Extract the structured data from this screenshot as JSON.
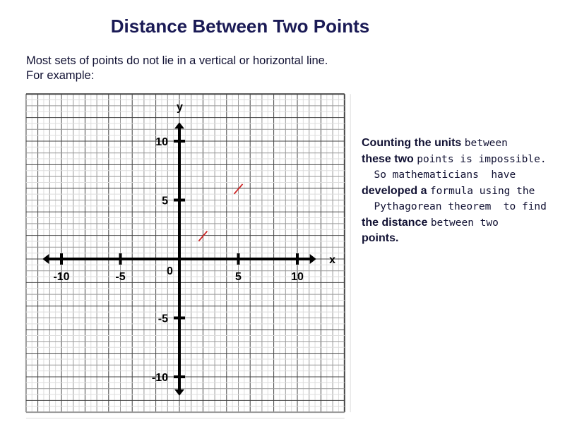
{
  "title": "Distance Between Two Points",
  "intro": [
    "Most sets of points do not lie in a vertical or horizontal line.",
    "For example:"
  ],
  "graph": {
    "x_axis_label": "x",
    "y_axis_label": "y",
    "origin_label": "0",
    "x_ticks": [
      {
        "value": -10,
        "label": "-10"
      },
      {
        "value": -5,
        "label": "-5"
      },
      {
        "value": 5,
        "label": "5"
      },
      {
        "value": 10,
        "label": "10"
      }
    ],
    "y_ticks": [
      {
        "value": 10,
        "label": "10"
      },
      {
        "value": 5,
        "label": "5"
      },
      {
        "value": -5,
        "label": "-5"
      },
      {
        "value": -10,
        "label": "-10"
      }
    ],
    "xlim": [
      -13,
      14
    ],
    "ylim": [
      -13,
      14
    ],
    "grid": true,
    "points": [
      {
        "x": 2,
        "y": 2
      },
      {
        "x": 5,
        "y": 6
      }
    ],
    "point_color": "#cc2222"
  },
  "side_text": [
    [
      {
        "t": "Counting the units ",
        "s": "b"
      },
      {
        "t": "between",
        "s": "m"
      }
    ],
    [
      {
        "t": "these two ",
        "s": "b"
      },
      {
        "t": "points is impossible.",
        "s": "m"
      }
    ],
    [
      {
        "t": "  So mathematicians  have",
        "s": "m"
      }
    ],
    [
      {
        "t": "developed a ",
        "s": "b"
      },
      {
        "t": "formula using the",
        "s": "m"
      }
    ],
    [
      {
        "t": "  Pythagorean theorem  to find",
        "s": "m"
      }
    ],
    [
      {
        "t": "the distance ",
        "s": "b"
      },
      {
        "t": "between two",
        "s": "m"
      }
    ],
    [
      {
        "t": "points.",
        "s": "b"
      }
    ]
  ]
}
